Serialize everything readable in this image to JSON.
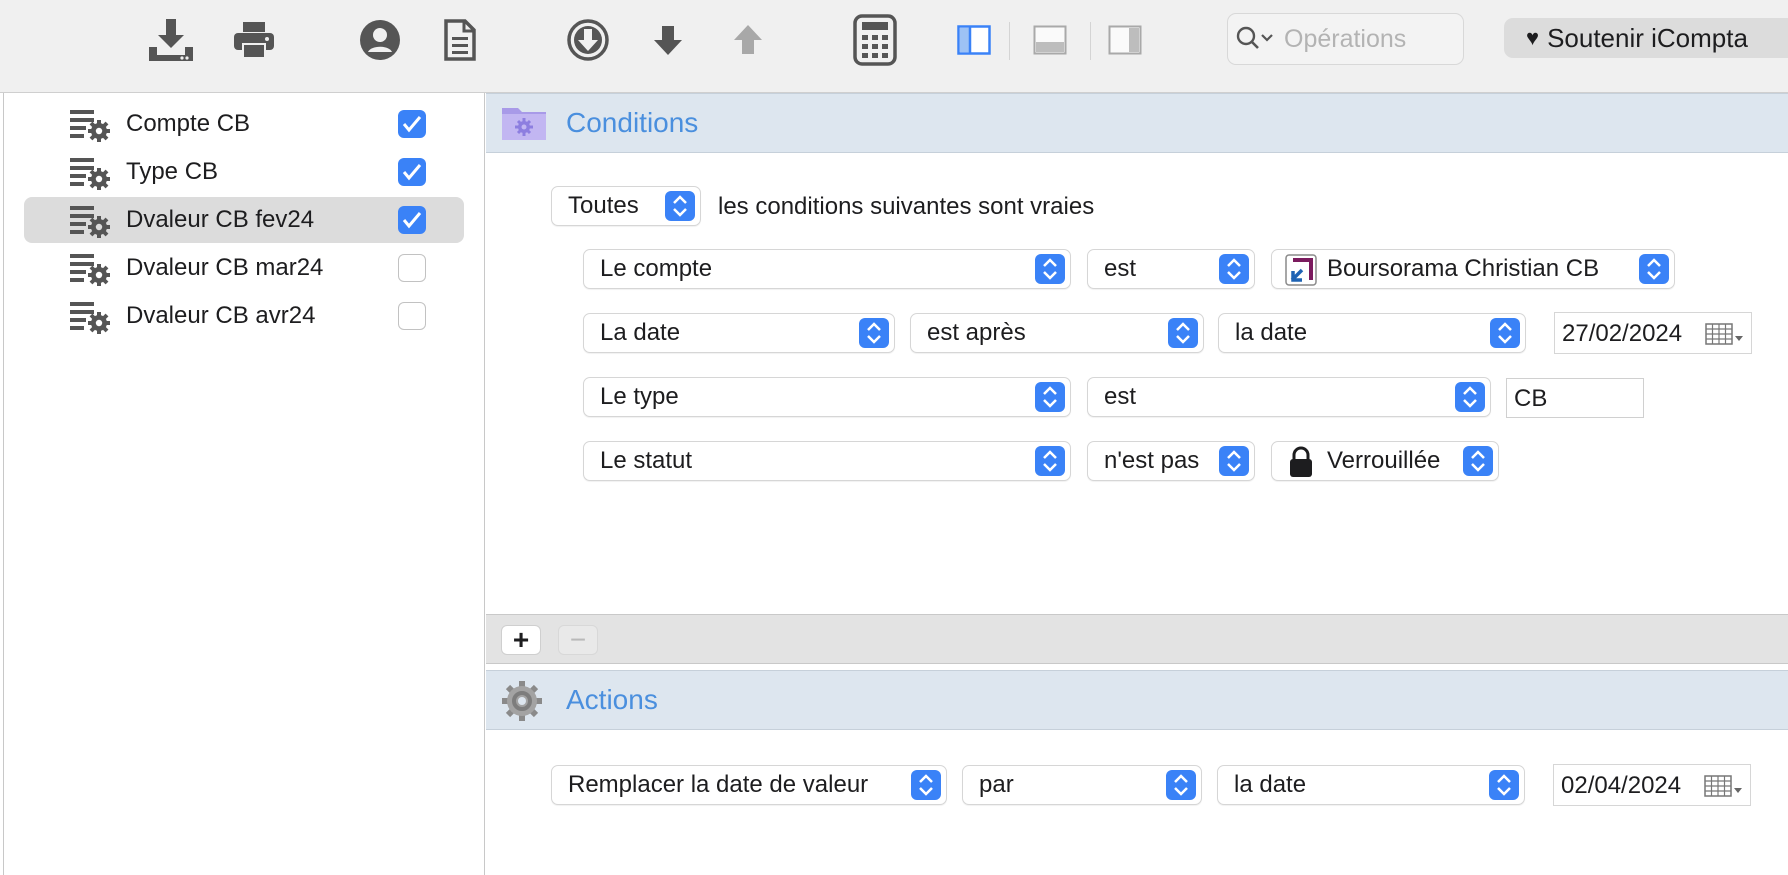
{
  "toolbar": {
    "buttons": [
      "download-icon",
      "print-icon",
      "account-icon",
      "document-icon",
      "circle-down-icon",
      "arrow-down-icon",
      "arrow-up-icon",
      "calculator-icon",
      "sidebar-left-icon",
      "panel-bottom-icon",
      "sidebar-right-icon"
    ],
    "search_placeholder": "Opérations",
    "support_label": "Soutenir iCompta",
    "support_icon": "heart-icon"
  },
  "sidebar": {
    "items": [
      {
        "label": "Compte CB",
        "checked": true,
        "selected": false
      },
      {
        "label": "Type CB",
        "checked": true,
        "selected": false
      },
      {
        "label": "Dvaleur CB fev24",
        "checked": true,
        "selected": true
      },
      {
        "label": "Dvaleur CB mar24",
        "checked": false,
        "selected": false
      },
      {
        "label": "Dvaleur CB avr24",
        "checked": false,
        "selected": false
      }
    ]
  },
  "conditions": {
    "title": "Conditions",
    "match_mode": "Toutes",
    "match_text": "les conditions suivantes sont vraies",
    "rows": [
      {
        "field": "Le compte",
        "operator": "est",
        "value": "Boursorama Christian CB"
      },
      {
        "field": "La date",
        "operator": "est après",
        "value": "la date",
        "date": "27/02/2024"
      },
      {
        "field": "Le type",
        "operator": "est",
        "text_value": "CB"
      },
      {
        "field": "Le statut",
        "operator": "n'est pas",
        "value": "Verrouillée"
      }
    ],
    "add_label": "+",
    "remove_label": "−"
  },
  "actions": {
    "title": "Actions",
    "action": "Remplacer la date de valeur",
    "operator": "par",
    "value": "la date",
    "date": "02/04/2024"
  },
  "colors": {
    "accent": "#3a82f7",
    "section_header_bg": "#dde6ef",
    "section_title": "#4a8fde",
    "selection": "#dcdcdc"
  }
}
